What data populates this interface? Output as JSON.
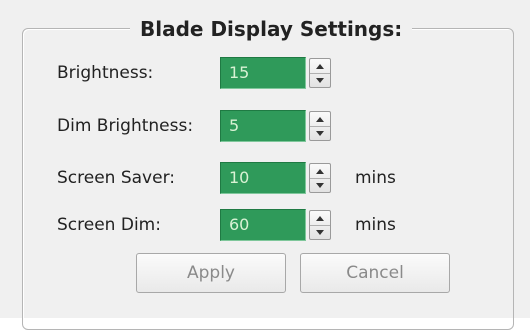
{
  "title": "Blade Display Settings:",
  "settings": [
    {
      "label": "Brightness:",
      "value": "15",
      "unit": ""
    },
    {
      "label": "Dim Brightness:",
      "value": "5",
      "unit": ""
    },
    {
      "label": "Screen Saver:",
      "value": "10",
      "unit": "mins"
    },
    {
      "label": "Screen Dim:",
      "value": "60",
      "unit": "mins"
    }
  ],
  "buttons": {
    "apply_label": "Apply",
    "cancel_label": "Cancel"
  },
  "colors": {
    "field_background": "#2f9a5a",
    "field_text": "#d9f2d4",
    "panel_background": "#f0f0f0"
  }
}
